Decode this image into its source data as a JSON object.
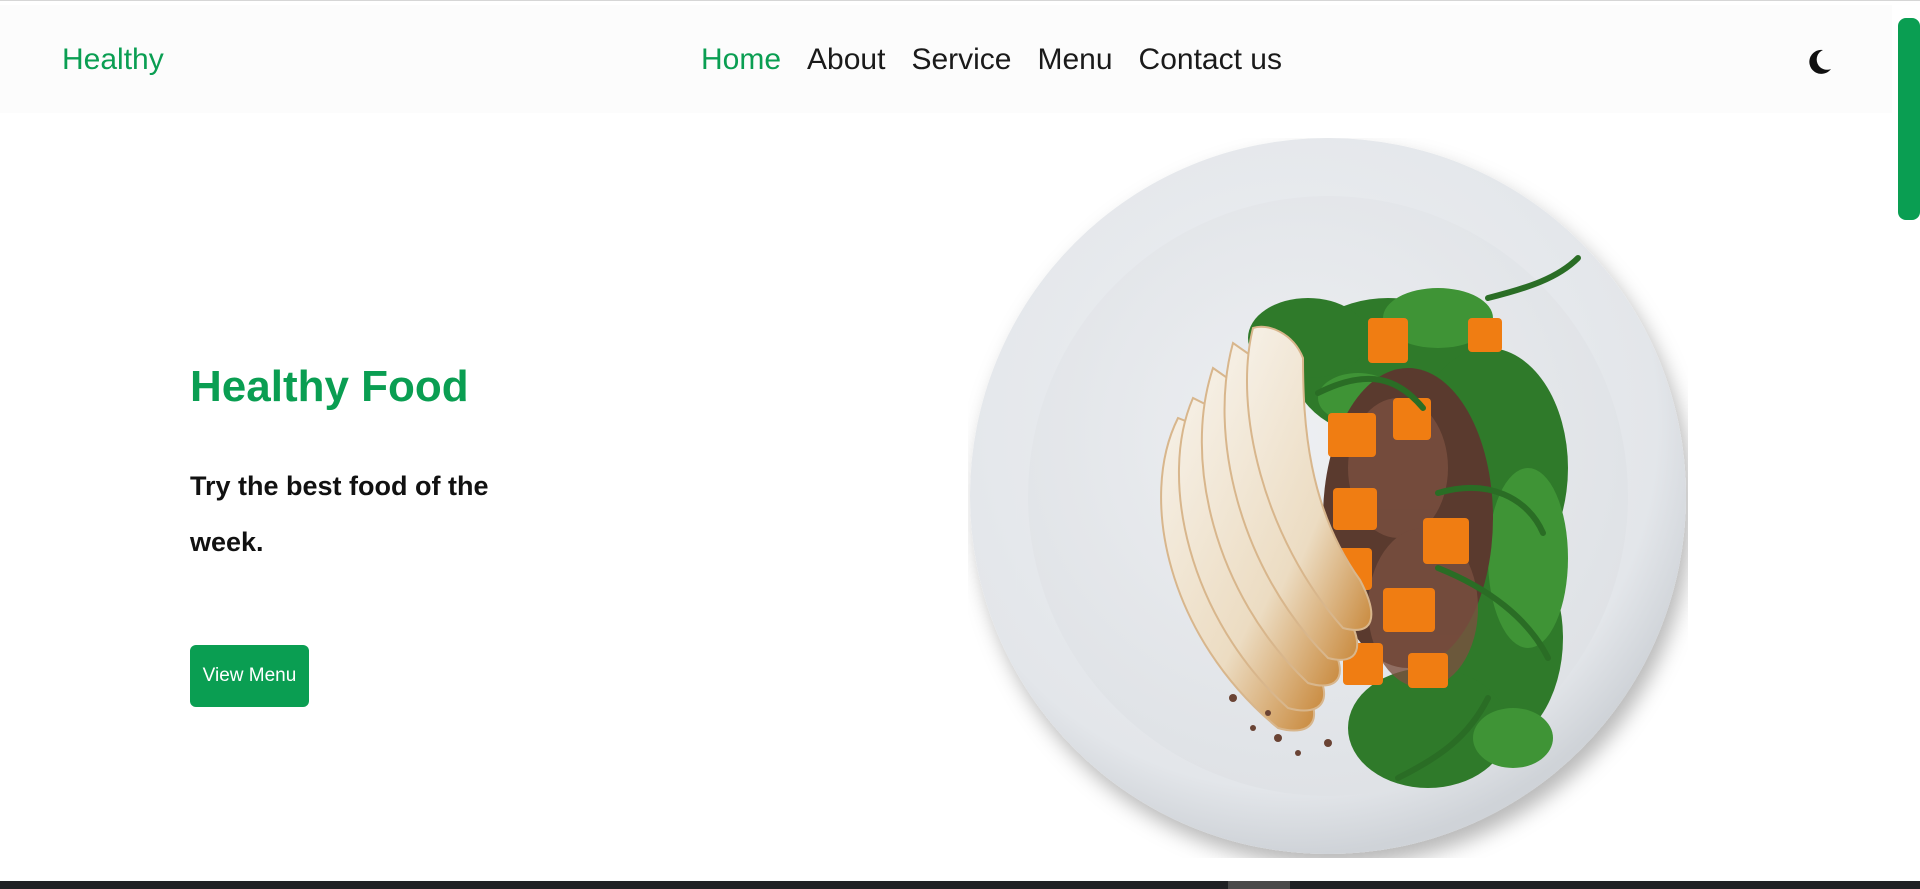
{
  "header": {
    "logo": "Healthy",
    "nav": [
      {
        "label": "Home",
        "active": true
      },
      {
        "label": "About",
        "active": false
      },
      {
        "label": "Service",
        "active": false
      },
      {
        "label": "Menu",
        "active": false
      },
      {
        "label": "Contact us",
        "active": false
      }
    ],
    "theme_toggle_icon": "moon-icon"
  },
  "hero": {
    "title": "Healthy Food",
    "subtitle": "Try the best food of the week.",
    "button_label": "View Menu",
    "image_icon": "plate-image"
  },
  "colors": {
    "accent": "#0a9e52",
    "text": "#111111",
    "header_bg": "#fcfcfc",
    "bottom_bar": "#202124"
  }
}
